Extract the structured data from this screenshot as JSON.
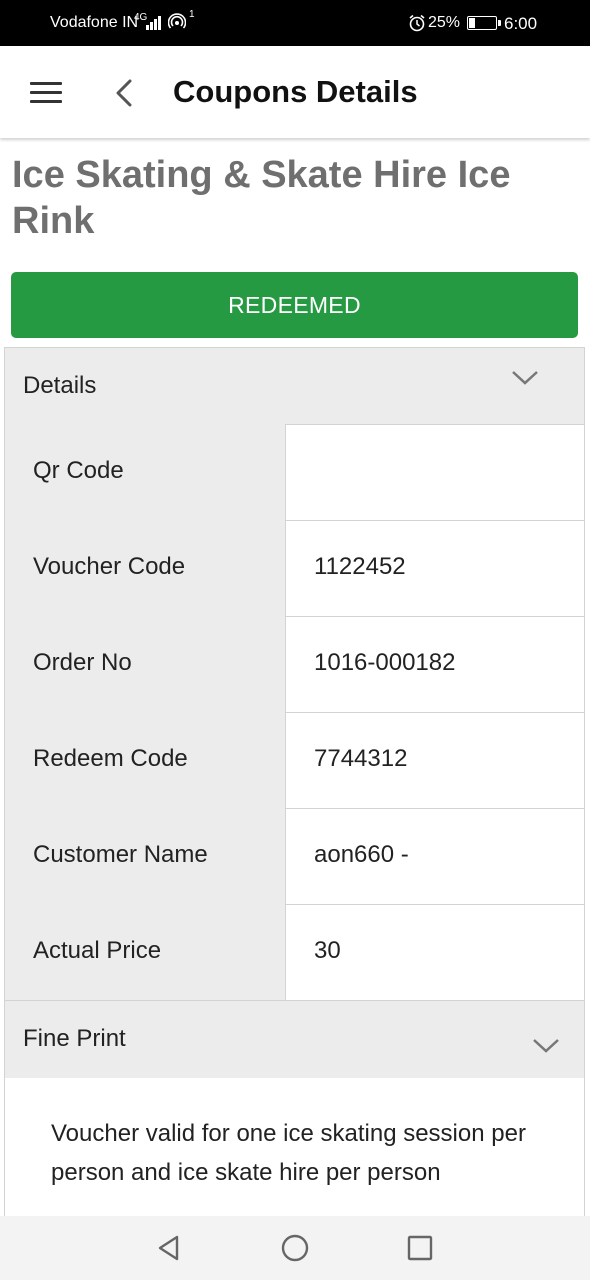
{
  "status_bar": {
    "carrier": "Vodafone IN",
    "network": "4G",
    "hotspot_count": "1",
    "battery": "25%",
    "battery_level": 0.25,
    "time": "6:00"
  },
  "app_bar": {
    "title": "Coupons Details",
    "menu_icon": "hamburger-menu-icon",
    "back_icon": "chevron-left-icon"
  },
  "coupon": {
    "title": "Ice Skating & Skate Hire Ice Rink",
    "status_label": "REDEEMED",
    "status_color": "#259a43"
  },
  "details": {
    "header": "Details",
    "rows": [
      {
        "label": "Qr Code",
        "value": ""
      },
      {
        "label": "Voucher Code",
        "value": "1122452"
      },
      {
        "label": "Order No",
        "value": "1016-000182"
      },
      {
        "label": "Redeem Code",
        "value": "7744312"
      },
      {
        "label": "Customer Name",
        "value": "aon660 -"
      },
      {
        "label": "Actual Price",
        "value": "30"
      }
    ]
  },
  "fine_print": {
    "header": "Fine Print",
    "text": "Voucher valid for one ice skating session per person and ice skate hire per person"
  },
  "nav_bar": {
    "icons": [
      "back-triangle-icon",
      "home-circle-icon",
      "recents-square-icon"
    ]
  }
}
